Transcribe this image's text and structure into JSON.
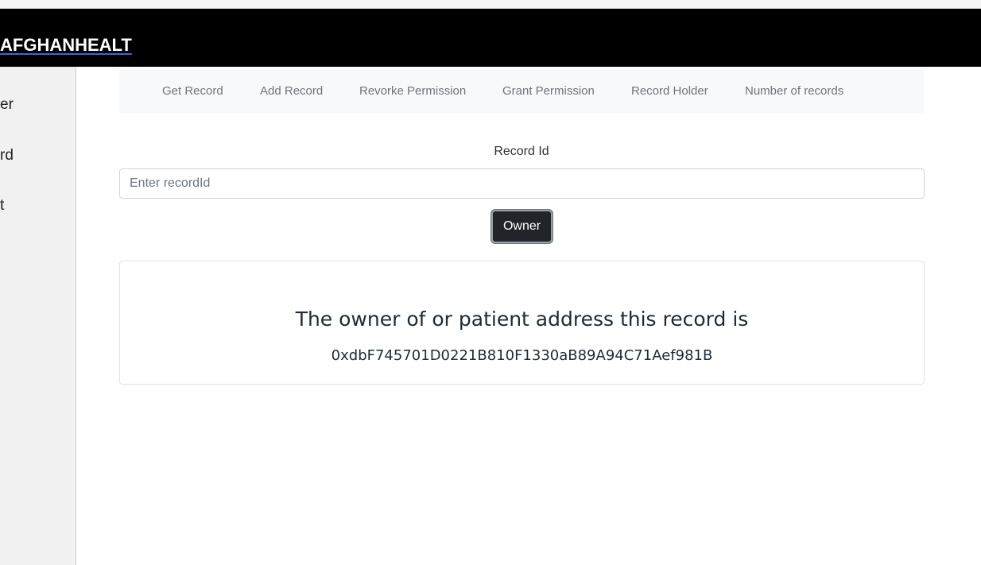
{
  "header": {
    "brand": "AFGHANHEALT"
  },
  "sidebar": {
    "items": [
      {
        "label": "er"
      },
      {
        "label": "rd"
      },
      {
        "label": "t"
      }
    ]
  },
  "nav": {
    "items": [
      {
        "label": "Get Record"
      },
      {
        "label": "Add Record"
      },
      {
        "label": "Revorke Permission"
      },
      {
        "label": "Grant Permission"
      },
      {
        "label": "Record Holder"
      },
      {
        "label": "Number of records"
      }
    ]
  },
  "form": {
    "label": "Record Id",
    "input_value": "",
    "input_placeholder": "Enter recordId",
    "button_label": "Owner"
  },
  "result": {
    "title": "The owner of or patient address this record is",
    "address": "0xdbF745701D0221B810F1330aB89A94C71Aef981B"
  },
  "colors": {
    "header_bg": "#000000",
    "button_bg": "#212529",
    "nav_bg": "#f8f9fa"
  }
}
